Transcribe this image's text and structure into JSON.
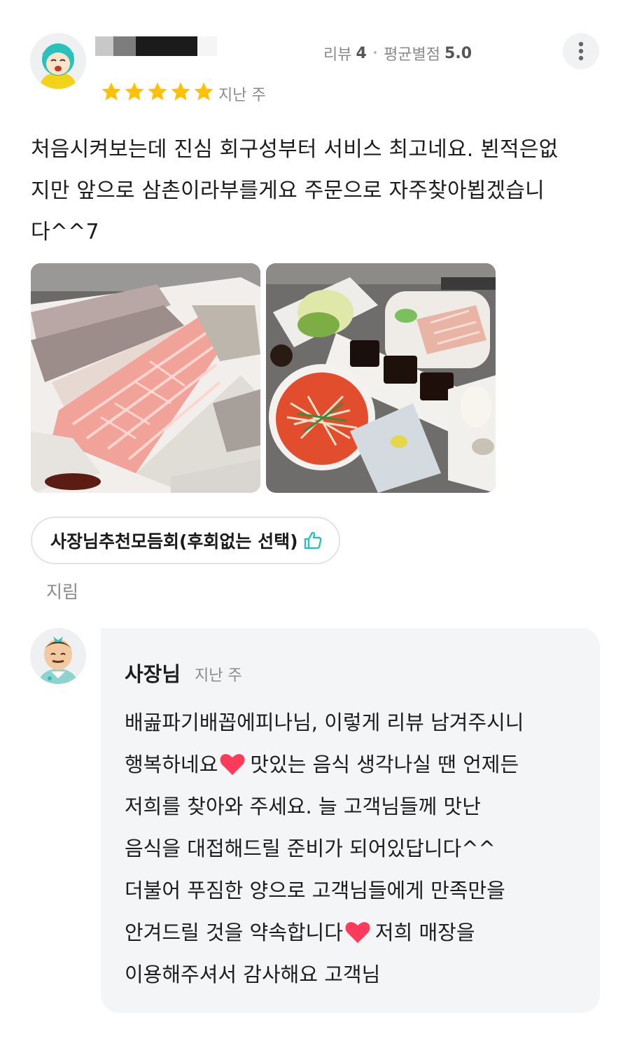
{
  "reviewer": {
    "stats_review_label": "리뷰",
    "stats_review_count": "4",
    "stats_rating_label": "평균별점",
    "stats_rating_value": "5.0"
  },
  "review": {
    "star_count": 5,
    "date": "지난 주",
    "text_lines": [
      "처음시켜보는데 진심 회구성부터 서비스 최고네요. 뵌적은없",
      "지만 앞으로 삼촌이라부를게요 주문으로 자주찾아뵙겠습니",
      "다^^7"
    ],
    "menu_item": "사장님추천모듬회(후회없는 선택)",
    "delivery_status": "지림"
  },
  "owner_reply": {
    "name": "사장님",
    "date": "지난 주",
    "lines": [
      {
        "before": "배곮파기배꼽에피나님, 이렇게 리뷰 남겨주시니",
        "after": ""
      },
      {
        "before": "행복하네요",
        "after": "맛있는 음식 생각나실 땐 언제든"
      },
      {
        "before": "저희를 찾아와 주세요. 늘 고객님들께 맛난",
        "after": ""
      },
      {
        "before": "음식을 대접해드릴 준비가 되어있답니다^^",
        "after": ""
      },
      {
        "before": "더불어 푸짐한 양으로 고객님들에게 만족만을",
        "after": ""
      },
      {
        "before": "안겨드릴 것을 약속합니다",
        "after": "저희 매장을"
      },
      {
        "before": "이용해주셔서 감사해요 고객님",
        "after": ""
      }
    ]
  },
  "colors": {
    "star": "#ffc107",
    "heart": "#ff3b5c",
    "accent_mint": "#2ac1bc"
  }
}
